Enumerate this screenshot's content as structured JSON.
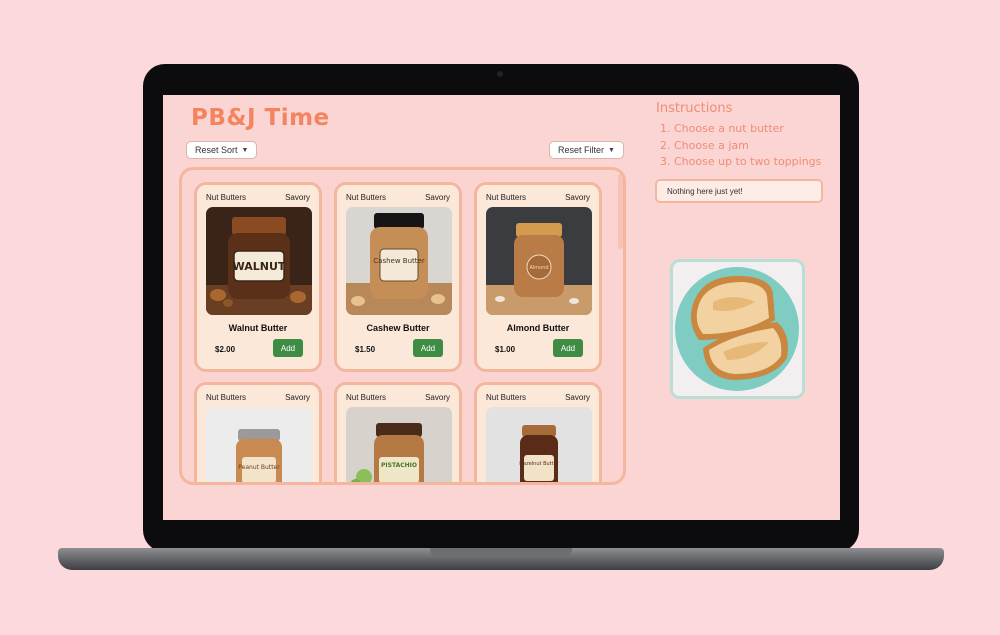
{
  "app": {
    "title": "PB&J Time"
  },
  "toolbar": {
    "reset_sort": "Reset Sort",
    "reset_filter": "Reset Filter"
  },
  "products": [
    {
      "category": "Nut Butters",
      "flavor": "Savory",
      "name": "Walnut Butter",
      "price": "$2.00",
      "add_label": "Add",
      "jar_label": "WALNUT"
    },
    {
      "category": "Nut Butters",
      "flavor": "Savory",
      "name": "Cashew Butter",
      "price": "$1.50",
      "add_label": "Add",
      "jar_label": "Cashew Butter"
    },
    {
      "category": "Nut Butters",
      "flavor": "Savory",
      "name": "Almond Butter",
      "price": "$1.00",
      "add_label": "Add",
      "jar_label": "Almond"
    },
    {
      "category": "Nut Butters",
      "flavor": "Savory",
      "jar_label": "Peanut Butter"
    },
    {
      "category": "Nut Butters",
      "flavor": "Savory",
      "jar_label": "PISTACHIO"
    },
    {
      "category": "Nut Butters",
      "flavor": "Savory",
      "jar_label": "Hazelnut Butter"
    }
  ],
  "instructions": {
    "title": "Instructions",
    "steps": [
      "1. Choose a nut butter",
      "2. Choose a jam",
      "3. Choose up to two toppings"
    ]
  },
  "selection": {
    "empty_text": "Nothing here just yet!"
  },
  "colors": {
    "accent": "#f4845f",
    "panel_border": "#f4b79e",
    "add_button": "#3f8d45",
    "background": "#fbd5d4"
  }
}
